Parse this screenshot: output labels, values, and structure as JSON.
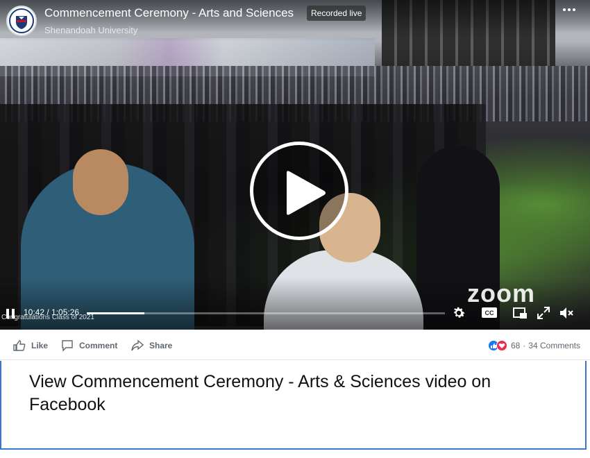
{
  "video": {
    "title": "Commencement Ceremony - Arts and Sciences",
    "channel": "Shenandoah University",
    "badge": "Recorded live",
    "watermark": "zoom",
    "caption": "Congratulations Class of 2021",
    "time": "10:42 / 1:05:26",
    "progress_fraction": 0.16
  },
  "actions": {
    "like": "Like",
    "comment": "Comment",
    "share": "Share"
  },
  "reactions": {
    "count": "68",
    "separator": "·",
    "comments": "34 Comments"
  },
  "cta": {
    "text": "View Commencement Ceremony - Arts & Sciences video on Facebook"
  },
  "icons": {
    "logo": "university-seal-icon",
    "more": "more-dots-icon",
    "play": "play-icon",
    "pause": "pause-icon",
    "settings": "gear-icon",
    "cc": "closed-captions-icon",
    "pip": "picture-in-picture-icon",
    "fullscreen": "fullscreen-icon",
    "mute": "muted-speaker-icon"
  },
  "colors": {
    "accent": "#3a78c5",
    "like": "#1877f2",
    "love": "#f0284a"
  }
}
